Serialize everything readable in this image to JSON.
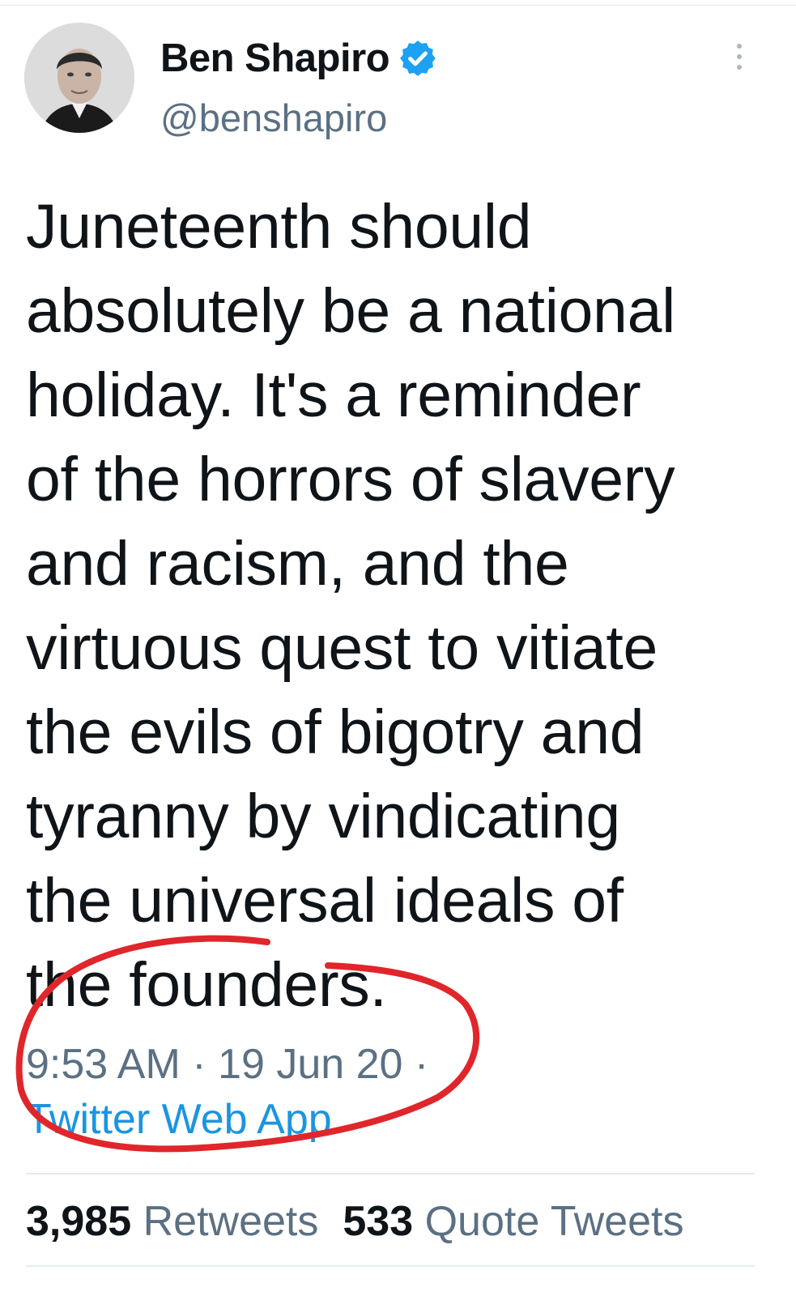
{
  "author": {
    "display_name": "Ben Shapiro",
    "handle": "@benshapiro",
    "verified": true
  },
  "tweet": {
    "text": "Juneteenth should\nabsolutely be a national\nholiday. It's a reminder\nof the horrors of slavery\nand racism, and the\nvirtuous quest to vitiate\nthe evils of bigotry and\ntyranny by vindicating\nthe universal ideals of\nthe founders.",
    "time": "9:53 AM",
    "separator": "·",
    "date": "19 Jun 20",
    "source": "Twitter Web App"
  },
  "stats": {
    "retweets_count": "3,985",
    "retweets_label": "Retweets",
    "quotes_count": "533",
    "quotes_label": "Quote Tweets"
  },
  "annotation": {
    "color": "#e0262b"
  },
  "colors": {
    "link": "#1b95e0",
    "muted": "#5b7083",
    "verified": "#1da1f2"
  }
}
